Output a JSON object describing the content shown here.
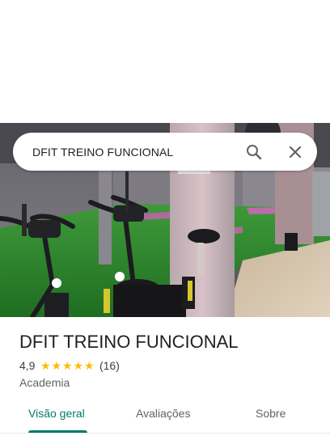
{
  "search": {
    "query": "DFIT TREINO FUNCIONAL"
  },
  "place": {
    "name": "DFIT TREINO FUNCIONAL",
    "rating": "4,9",
    "rating_stars": 5,
    "review_count": "(16)",
    "category": "Academia"
  },
  "tabs": [
    {
      "label": "Visão geral",
      "active": true
    },
    {
      "label": "Avaliações",
      "active": false
    },
    {
      "label": "Sobre",
      "active": false
    }
  ],
  "icons": {
    "search": "search-icon",
    "close": "close-icon",
    "star": "star-icon"
  },
  "colors": {
    "accent": "#01796f",
    "star": "#fbbc04",
    "title": "#202124",
    "secondary": "#5f6368"
  }
}
